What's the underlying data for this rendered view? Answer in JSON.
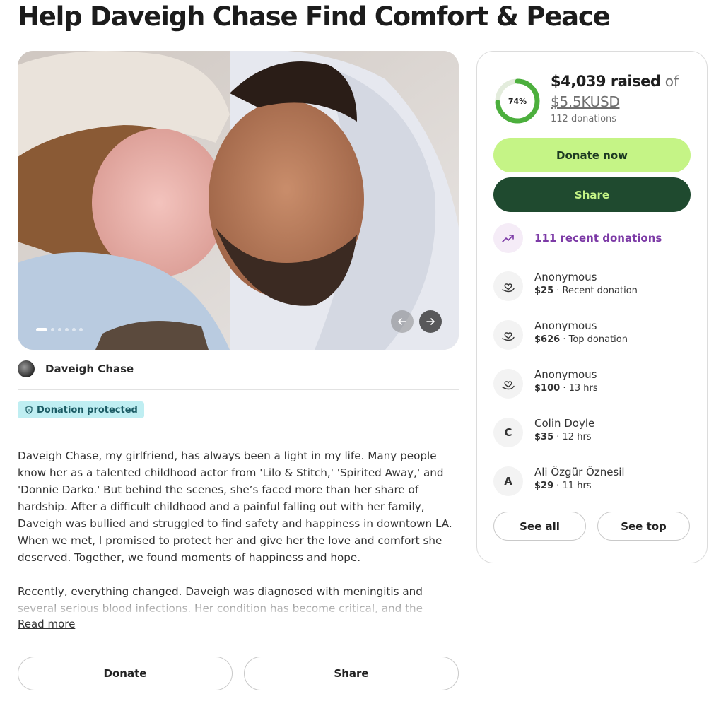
{
  "page": {
    "title": "Help Daveigh Chase Find Comfort & Peace"
  },
  "hero": {
    "slide_count": 6,
    "active_slide": 1,
    "prev_icon": "arrow-left-icon",
    "next_icon": "arrow-right-icon"
  },
  "organizer": {
    "name": "Daveigh Chase"
  },
  "badge": {
    "label": "Donation protected",
    "icon": "shield-icon"
  },
  "story": {
    "paragraph1": "Daveigh Chase, my girlfriend, has always been a light in my life. Many people know her as a talented childhood actor from 'Lilo & Stitch,' 'Spirited Away,' and 'Donnie Darko.' But behind the scenes, she’s faced more than her share of hardship. After a difficult childhood and a painful falling out with her family, Daveigh was bullied and struggled to find safety and happiness in downtown LA. When we met, I promised to protect her and give her the love and comfort she deserved. Together, we found moments of happiness and hope.",
    "paragraph2": "Recently, everything changed. Daveigh was diagnosed with meningitis and several serious blood infections. Her condition has become critical, and the doctors have",
    "read_more": "Read more"
  },
  "bottom_actions": {
    "donate": "Donate",
    "share": "Share"
  },
  "sidebar": {
    "progress_percent": 74,
    "progress_label": "74%",
    "raised_amount": "$4,039 raised",
    "raised_of": " of",
    "goal": "$5.5KUSD",
    "donations_count": "112 donations",
    "donate_now": "Donate now",
    "share": "Share",
    "recent_label": "111 recent donations",
    "colors": {
      "progress": "#4caf3d",
      "donate_button": "#c5f486",
      "share_button": "#1f4a2f",
      "recent_text": "#7c3aa6"
    },
    "donors": [
      {
        "name": "Anonymous",
        "amount": "$25",
        "note": " · Recent donation",
        "icon": "heart-hand-icon"
      },
      {
        "name": "Anonymous",
        "amount": "$626",
        "note": " · Top donation",
        "icon": "heart-hand-icon"
      },
      {
        "name": "Anonymous",
        "amount": "$100",
        "note": " · 13 hrs",
        "icon": "heart-hand-icon"
      },
      {
        "name": "Colin Doyle",
        "amount": "$35",
        "note": " · 12 hrs",
        "initial": "C"
      },
      {
        "name": "Ali Özgür Öznesil",
        "amount": "$29",
        "note": " · 11 hrs",
        "initial": "A"
      }
    ],
    "see_all": "See all",
    "see_top": "See top"
  }
}
